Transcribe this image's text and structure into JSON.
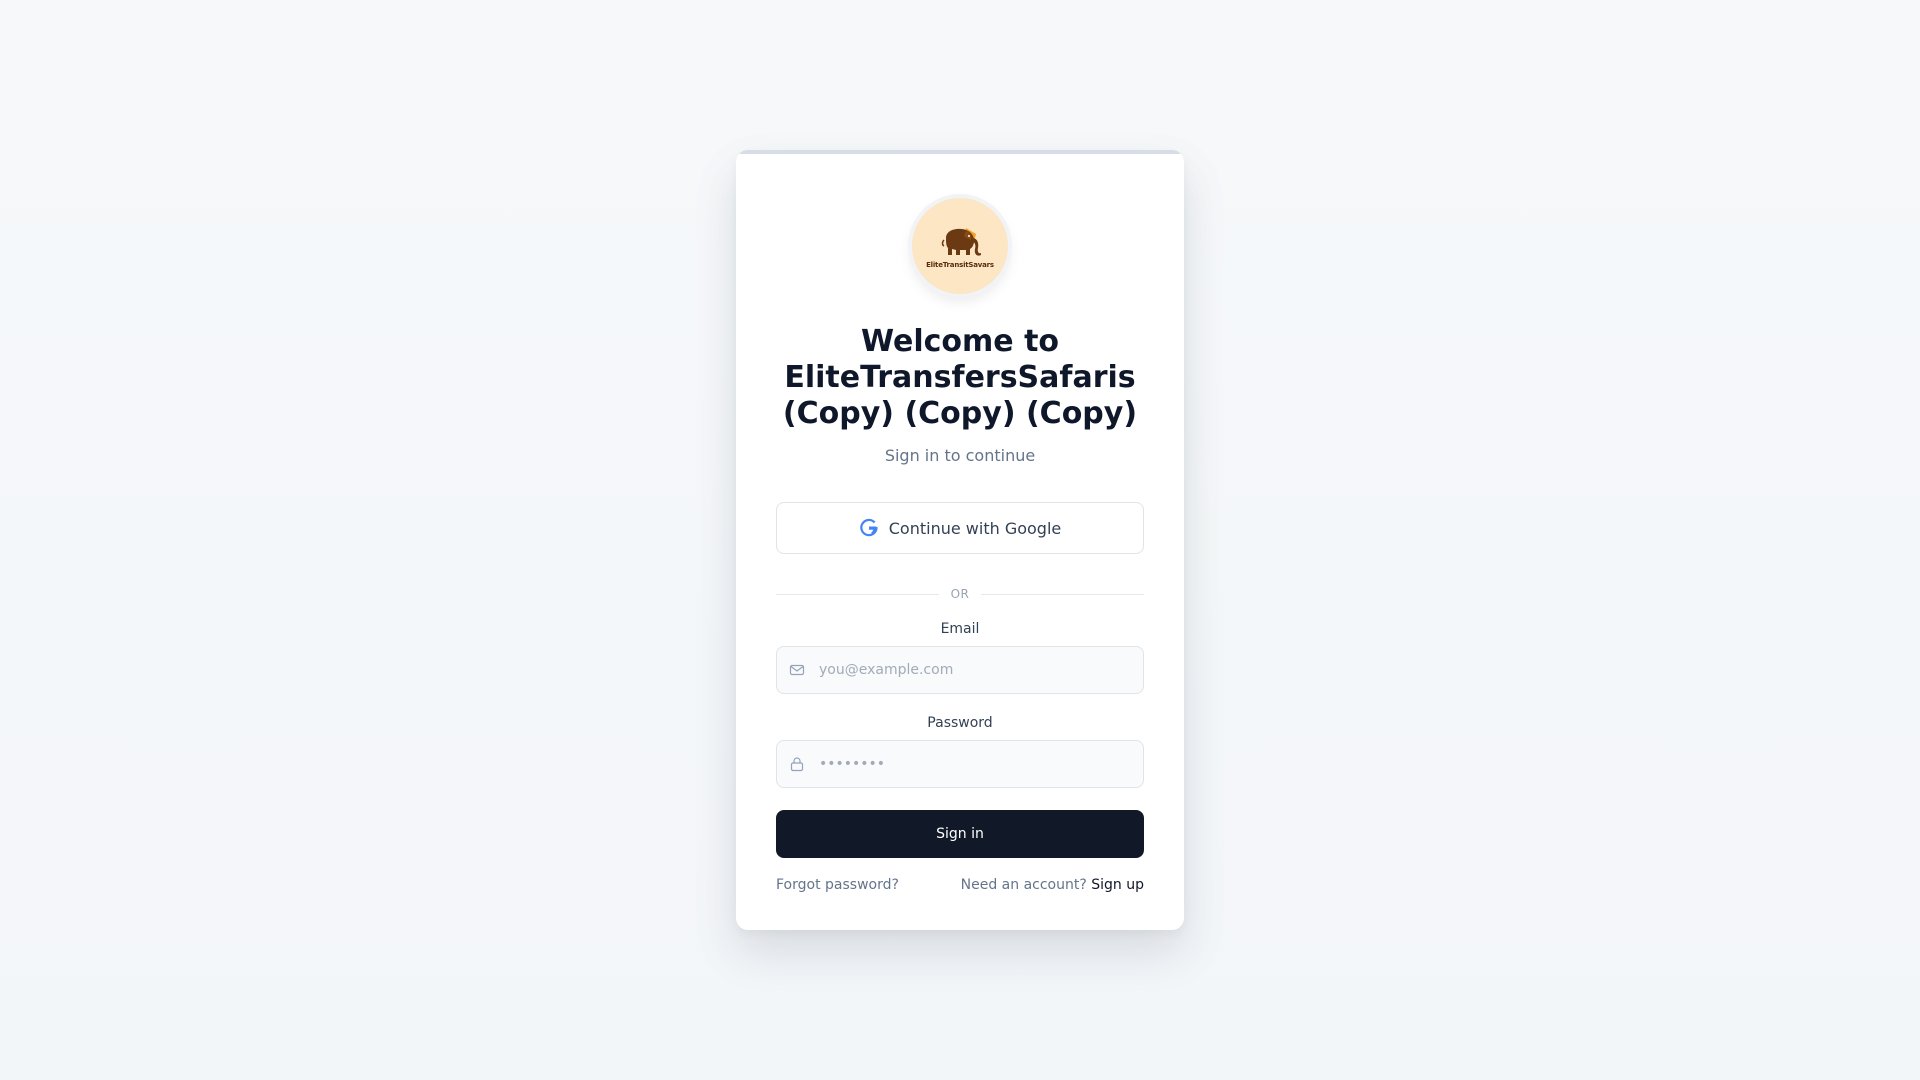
{
  "brand": {
    "logo_text": "EliteTransitSavars",
    "logo_bg": "#fde6c4"
  },
  "header": {
    "title": "Welcome to EliteTransfersSafaris (Copy) (Copy) (Copy)",
    "subtitle": "Sign in to continue"
  },
  "oauth": {
    "google_label": "Continue with Google"
  },
  "divider": {
    "label": "OR"
  },
  "form": {
    "email_label": "Email",
    "email_placeholder": "you@example.com",
    "email_icon": "mail-icon",
    "password_label": "Password",
    "password_placeholder": "••••••••",
    "password_icon": "lock-icon",
    "submit_label": "Sign in"
  },
  "footer": {
    "forgot_label": "Forgot password?",
    "need_account_label": "Need an account?",
    "signup_label": "Sign up"
  },
  "colors": {
    "primary_button": "#111827",
    "page_bg": "#f5f7fa",
    "google_blue": "#4285f4"
  }
}
